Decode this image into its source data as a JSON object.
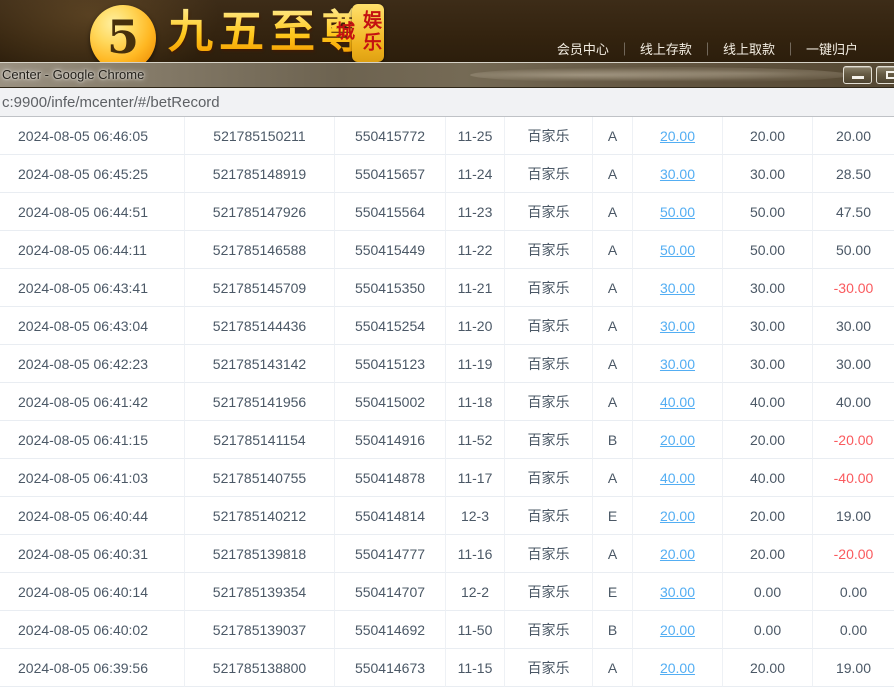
{
  "colors": {
    "banner_bg": "#33230f",
    "gold_accent": "#ffc91e",
    "badge_red": "#c41111",
    "link_blue": "#53aef3",
    "negative_red": "#fa5a5e",
    "table_text": "#4b5866"
  },
  "site_header": {
    "logo_glyph": "5",
    "brand": "九五至尊",
    "badge": "娱乐城",
    "nav_separator": "｜",
    "nav": [
      {
        "label": "会员中心"
      },
      {
        "label": "线上存款"
      },
      {
        "label": "线上取款"
      },
      {
        "label": "一键归户"
      }
    ]
  },
  "browser": {
    "window_title": "Center - Google Chrome",
    "url": "c:9900/infe/mcenter/#/betRecord"
  },
  "table": {
    "columns": [
      "bet_time",
      "bet_id",
      "round_id",
      "table_no",
      "game",
      "seat",
      "bet_amount",
      "valid_amount",
      "result"
    ],
    "rows": [
      {
        "bet_time": "2024-08-05 06:46:05",
        "bet_id": "521785150211",
        "round_id": "550415772",
        "table_no": "11-25",
        "game": "百家乐",
        "seat": "A",
        "bet_amount": "20.00",
        "valid_amount": "20.00",
        "result": "20.00"
      },
      {
        "bet_time": "2024-08-05 06:45:25",
        "bet_id": "521785148919",
        "round_id": "550415657",
        "table_no": "11-24",
        "game": "百家乐",
        "seat": "A",
        "bet_amount": "30.00",
        "valid_amount": "30.00",
        "result": "28.50"
      },
      {
        "bet_time": "2024-08-05 06:44:51",
        "bet_id": "521785147926",
        "round_id": "550415564",
        "table_no": "11-23",
        "game": "百家乐",
        "seat": "A",
        "bet_amount": "50.00",
        "valid_amount": "50.00",
        "result": "47.50"
      },
      {
        "bet_time": "2024-08-05 06:44:11",
        "bet_id": "521785146588",
        "round_id": "550415449",
        "table_no": "11-22",
        "game": "百家乐",
        "seat": "A",
        "bet_amount": "50.00",
        "valid_amount": "50.00",
        "result": "50.00"
      },
      {
        "bet_time": "2024-08-05 06:43:41",
        "bet_id": "521785145709",
        "round_id": "550415350",
        "table_no": "11-21",
        "game": "百家乐",
        "seat": "A",
        "bet_amount": "30.00",
        "valid_amount": "30.00",
        "result": "-30.00"
      },
      {
        "bet_time": "2024-08-05 06:43:04",
        "bet_id": "521785144436",
        "round_id": "550415254",
        "table_no": "11-20",
        "game": "百家乐",
        "seat": "A",
        "bet_amount": "30.00",
        "valid_amount": "30.00",
        "result": "30.00"
      },
      {
        "bet_time": "2024-08-05 06:42:23",
        "bet_id": "521785143142",
        "round_id": "550415123",
        "table_no": "11-19",
        "game": "百家乐",
        "seat": "A",
        "bet_amount": "30.00",
        "valid_amount": "30.00",
        "result": "30.00"
      },
      {
        "bet_time": "2024-08-05 06:41:42",
        "bet_id": "521785141956",
        "round_id": "550415002",
        "table_no": "11-18",
        "game": "百家乐",
        "seat": "A",
        "bet_amount": "40.00",
        "valid_amount": "40.00",
        "result": "40.00"
      },
      {
        "bet_time": "2024-08-05 06:41:15",
        "bet_id": "521785141154",
        "round_id": "550414916",
        "table_no": "11-52",
        "game": "百家乐",
        "seat": "B",
        "bet_amount": "20.00",
        "valid_amount": "20.00",
        "result": "-20.00"
      },
      {
        "bet_time": "2024-08-05 06:41:03",
        "bet_id": "521785140755",
        "round_id": "550414878",
        "table_no": "11-17",
        "game": "百家乐",
        "seat": "A",
        "bet_amount": "40.00",
        "valid_amount": "40.00",
        "result": "-40.00"
      },
      {
        "bet_time": "2024-08-05 06:40:44",
        "bet_id": "521785140212",
        "round_id": "550414814",
        "table_no": "12-3",
        "game": "百家乐",
        "seat": "E",
        "bet_amount": "20.00",
        "valid_amount": "20.00",
        "result": "19.00"
      },
      {
        "bet_time": "2024-08-05 06:40:31",
        "bet_id": "521785139818",
        "round_id": "550414777",
        "table_no": "11-16",
        "game": "百家乐",
        "seat": "A",
        "bet_amount": "20.00",
        "valid_amount": "20.00",
        "result": "-20.00"
      },
      {
        "bet_time": "2024-08-05 06:40:14",
        "bet_id": "521785139354",
        "round_id": "550414707",
        "table_no": "12-2",
        "game": "百家乐",
        "seat": "E",
        "bet_amount": "30.00",
        "valid_amount": "0.00",
        "result": "0.00"
      },
      {
        "bet_time": "2024-08-05 06:40:02",
        "bet_id": "521785139037",
        "round_id": "550414692",
        "table_no": "11-50",
        "game": "百家乐",
        "seat": "B",
        "bet_amount": "20.00",
        "valid_amount": "0.00",
        "result": "0.00"
      },
      {
        "bet_time": "2024-08-05 06:39:56",
        "bet_id": "521785138800",
        "round_id": "550414673",
        "table_no": "11-15",
        "game": "百家乐",
        "seat": "A",
        "bet_amount": "20.00",
        "valid_amount": "20.00",
        "result": "19.00"
      }
    ]
  }
}
